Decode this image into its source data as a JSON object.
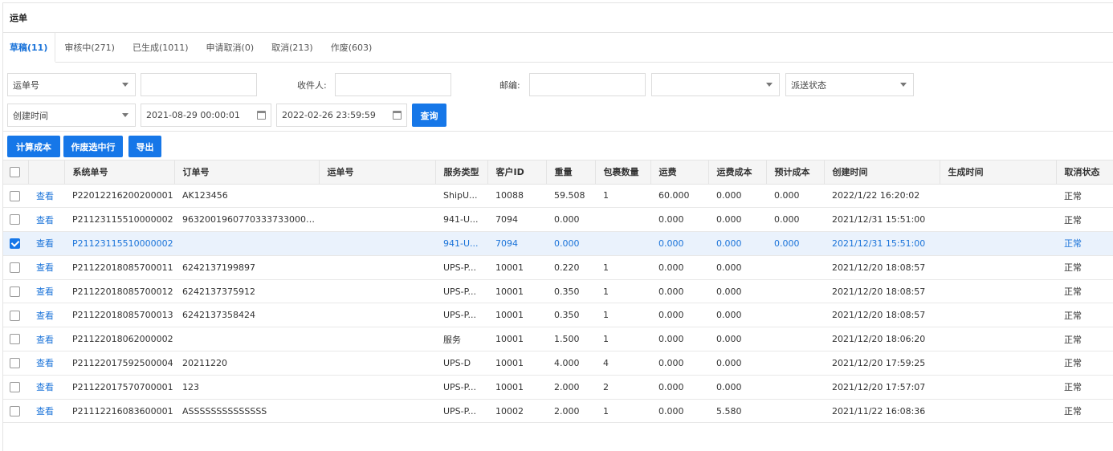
{
  "title": "运单",
  "tabs": [
    {
      "label": "草稿(11)",
      "active": true
    },
    {
      "label": "审核中(271)"
    },
    {
      "label": "已生成(1011)"
    },
    {
      "label": "申请取消(0)"
    },
    {
      "label": "取消(213)"
    },
    {
      "label": "作废(603)"
    }
  ],
  "filters": {
    "field_select": "运单号",
    "field_value": "",
    "recipient_label": "收件人:",
    "recipient_value": "",
    "zip_label": "邮编:",
    "zip_value": "",
    "extra_select": "",
    "delivery_status": "派送状态",
    "time_select": "创建时间",
    "start_date": "2021-08-29 00:00:01",
    "end_date": "2022-02-26 23:59:59",
    "query_button": "查询"
  },
  "actions": {
    "calc_cost": "计算成本",
    "void_selected": "作废选中行",
    "export": "导出"
  },
  "table": {
    "view_label": "查看",
    "columns": [
      "系统单号",
      "订单号",
      "运单号",
      "服务类型",
      "客户ID",
      "重量",
      "包裹数量",
      "运费",
      "运费成本",
      "预计成本",
      "创建时间",
      "生成时间",
      "取消状态"
    ],
    "rows": [
      {
        "checked": false,
        "sys": "P22012216200200001",
        "order": "AK123456",
        "waybill": "",
        "service": "ShipU...",
        "cust": "10088",
        "weight": "59.508",
        "pkgs": "1",
        "fee": "60.000",
        "fee_cost": "0.000",
        "est_cost": "0.000",
        "created": "2022/1/22 16:20:02",
        "generated": "",
        "cancel": "正常"
      },
      {
        "checked": false,
        "sys": "P21123115510000002",
        "order": "963200196077033373300050​6...",
        "waybill": "",
        "service": "941-U...",
        "cust": "7094",
        "weight": "0.000",
        "pkgs": "",
        "fee": "0.000",
        "fee_cost": "0.000",
        "est_cost": "0.000",
        "created": "2021/12/31 15:51:00",
        "generated": "",
        "cancel": "正常"
      },
      {
        "checked": true,
        "sys": "P21123115510000002",
        "order": "",
        "waybill": "",
        "service": "941-U...",
        "cust": "7094",
        "weight": "0.000",
        "pkgs": "",
        "fee": "0.000",
        "fee_cost": "0.000",
        "est_cost": "0.000",
        "created": "2021/12/31 15:51:00",
        "generated": "",
        "cancel": "正常"
      },
      {
        "checked": false,
        "sys": "P21122018085700011",
        "order": "6242137199897",
        "waybill": "",
        "service": "UPS-P...",
        "cust": "10001",
        "weight": "0.220",
        "pkgs": "1",
        "fee": "0.000",
        "fee_cost": "0.000",
        "est_cost": "",
        "created": "2021/12/20 18:08:57",
        "generated": "",
        "cancel": "正常"
      },
      {
        "checked": false,
        "sys": "P21122018085700012",
        "order": "6242137375912",
        "waybill": "",
        "service": "UPS-P...",
        "cust": "10001",
        "weight": "0.350",
        "pkgs": "1",
        "fee": "0.000",
        "fee_cost": "0.000",
        "est_cost": "",
        "created": "2021/12/20 18:08:57",
        "generated": "",
        "cancel": "正常"
      },
      {
        "checked": false,
        "sys": "P21122018085700013",
        "order": "6242137358424",
        "waybill": "",
        "service": "UPS-P...",
        "cust": "10001",
        "weight": "0.350",
        "pkgs": "1",
        "fee": "0.000",
        "fee_cost": "0.000",
        "est_cost": "",
        "created": "2021/12/20 18:08:57",
        "generated": "",
        "cancel": "正常"
      },
      {
        "checked": false,
        "sys": "P21122018062000002",
        "order": "",
        "waybill": "",
        "service": "服务",
        "cust": "10001",
        "weight": "1.500",
        "pkgs": "1",
        "fee": "0.000",
        "fee_cost": "0.000",
        "est_cost": "",
        "created": "2021/12/20 18:06:20",
        "generated": "",
        "cancel": "正常"
      },
      {
        "checked": false,
        "sys": "P21122017592500004",
        "order": "20211220",
        "waybill": "",
        "service": "UPS-D",
        "cust": "10001",
        "weight": "4.000",
        "pkgs": "4",
        "fee": "0.000",
        "fee_cost": "0.000",
        "est_cost": "",
        "created": "2021/12/20 17:59:25",
        "generated": "",
        "cancel": "正常"
      },
      {
        "checked": false,
        "sys": "P21122017570700001",
        "order": "123",
        "waybill": "",
        "service": "UPS-P...",
        "cust": "10001",
        "weight": "2.000",
        "pkgs": "2",
        "fee": "0.000",
        "fee_cost": "0.000",
        "est_cost": "",
        "created": "2021/12/20 17:57:07",
        "generated": "",
        "cancel": "正常"
      },
      {
        "checked": false,
        "sys": "P21112216083600001",
        "order": "ASSSSSSSSSSSSSS",
        "waybill": "",
        "service": "UPS-P...",
        "cust": "10002",
        "weight": "2.000",
        "pkgs": "1",
        "fee": "0.000",
        "fee_cost": "5.580",
        "est_cost": "",
        "created": "2021/11/22 16:08:36",
        "generated": "",
        "cancel": "正常"
      }
    ]
  }
}
